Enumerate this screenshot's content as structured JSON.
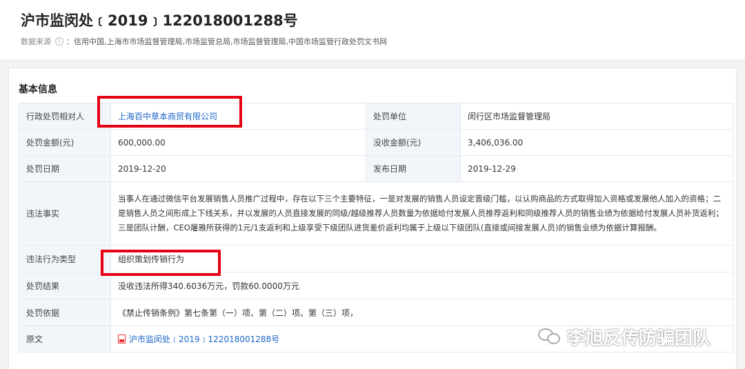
{
  "header": {
    "title": "沪市监闵处﹝2019﹞122018001288号",
    "source_label": "数据来源",
    "source_value": "信用中国,上海市市场监督管理局,市场监管总局,市场监督管理局,中国市场监管行政处罚文书网"
  },
  "section": {
    "title": "基本信息"
  },
  "rows": {
    "party_label": "行政处罚相对人",
    "party_value": "上海百中草本商贸有限公司",
    "unit_label": "处罚单位",
    "unit_value": "闵行区市场监督管理局",
    "fine_label": "处罚金额(元)",
    "fine_value": "600,000.00",
    "confiscate_label": "没收金额(元)",
    "confiscate_value": "3,406,036.00",
    "date_label": "处罚日期",
    "date_value": "2019-12-20",
    "publish_label": "发布日期",
    "publish_value": "2019-12-29",
    "facts_label": "违法事实",
    "facts_value": "当事人在通过微信平台发展销售人员推广过程中，存在以下三个主要特征，一是对发展的销售人员设定晋级门槛，以认购商品的方式取得加入资格或发展他人加入的资格；二是销售人员之间形成上下线关系，并以发展的人员直接发展的同级/越级推荐人员数量为依据给付发展人员推荐返利和同级推荐人员的销售业绩为依据给付发展人员补货返利；三是团队计酬，CEO屠雅所获得的1元/1支返利和上级享受下级团队进货差价返利均属于上级以下级团队(直接或间接发展人员)的销售业绩为依据计算报酬。",
    "type_label": "违法行为类型",
    "type_value": "组织策划传销行为",
    "result_label": "处罚结果",
    "result_value": "没收违法所得340.6036万元，罚款60.0000万元",
    "basis_label": "处罚依据",
    "basis_value": "《禁止传销条例》第七条第（一）项、第（二）项、第（三）项，",
    "original_label": "原文",
    "original_value": "沪市监闵处﹝2019﹞122018001288号"
  },
  "watermark": {
    "text": "李旭反传防骗团队"
  },
  "colors": {
    "link": "#1a64c8",
    "highlight": "#e60012",
    "label_bg": "#f2f6fb"
  }
}
